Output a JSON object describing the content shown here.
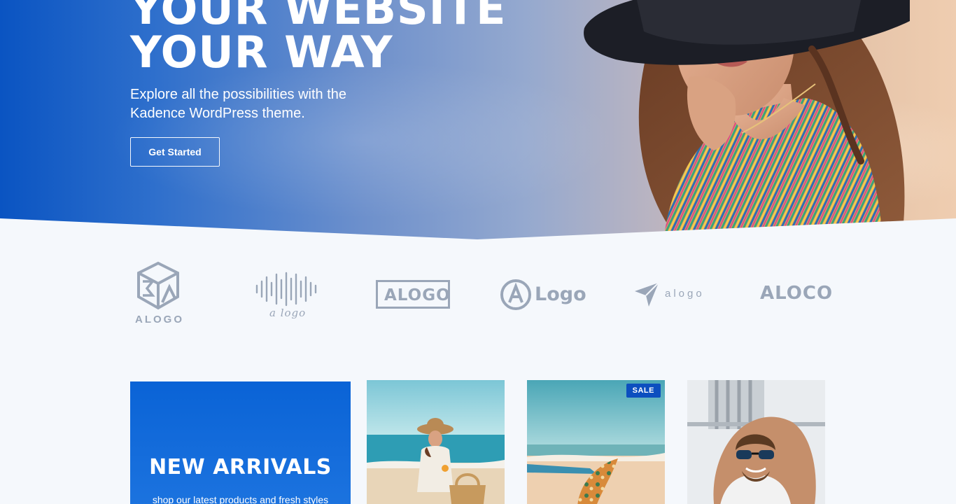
{
  "hero": {
    "title_line1": "YOUR WEBSITE",
    "title_line2": "YOUR WAY",
    "subtitle": "Explore all the possibilities with the Kadence WordPress theme.",
    "cta_label": "Get Started"
  },
  "logos": [
    {
      "icon": "cube-logo-icon",
      "text": "ALOGO"
    },
    {
      "icon": "soundwave-logo-icon",
      "text": "a logo"
    },
    {
      "icon": "boxed-logo-icon",
      "text": "ALOGO"
    },
    {
      "icon": "circle-a-logo-icon",
      "text": "Logo"
    },
    {
      "icon": "paper-plane-logo-icon",
      "text": "alogo"
    },
    {
      "icon": "wordmark-logo-icon",
      "text": "ALOCO"
    }
  ],
  "promo": {
    "title": "NEW ARRIVALS",
    "subtitle": "shop our latest products and fresh styles"
  },
  "products": [
    {
      "image": "woman-beach-hat-photo",
      "badge": ""
    },
    {
      "image": "surfboard-beach-photo",
      "badge": "SALE"
    },
    {
      "image": "man-sunglasses-photo",
      "badge": ""
    }
  ],
  "colors": {
    "brand_blue": "#0a54c2",
    "logo_gray": "#9aa6b8",
    "page_bg": "#f5f8fc"
  }
}
